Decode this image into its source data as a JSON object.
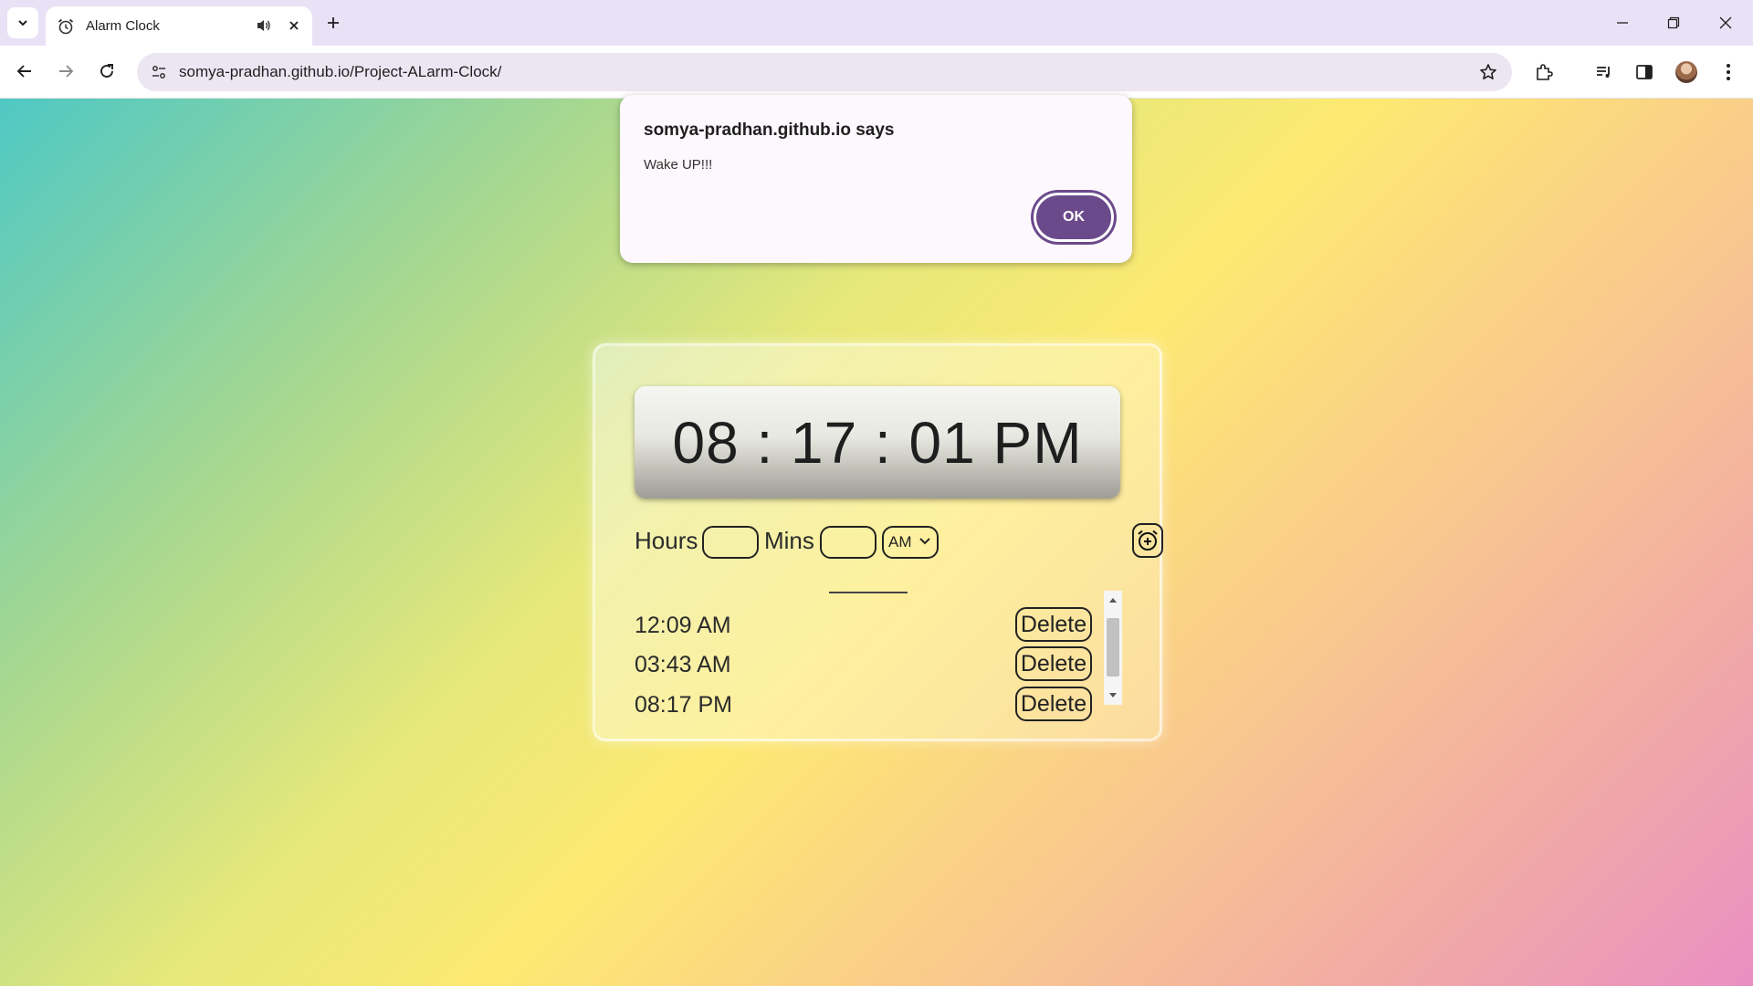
{
  "browser": {
    "tab": {
      "title": "Alarm Clock",
      "favicon": "alarm-clock-icon",
      "audio_icon": "speaker-icon"
    },
    "url": "somya-pradhan.github.io/Project-ALarm-Clock/",
    "accent": "#e9e1f5"
  },
  "dialog": {
    "title": "somya-pradhan.github.io says",
    "message": "Wake UP!!!",
    "ok_label": "OK",
    "button_color": "#6b4a8c"
  },
  "clock": {
    "display": "08 : 17 : 01 PM"
  },
  "controls": {
    "hours_label": "Hours",
    "mins_label": "Mins",
    "hours_value": "",
    "mins_value": "",
    "ampm_selected": "AM",
    "add_icon": "alarm-add-icon"
  },
  "alarms": [
    {
      "time": "12:09 AM",
      "delete_label": "Delete"
    },
    {
      "time": "03:43 AM",
      "delete_label": "Delete"
    },
    {
      "time": "08:17 PM",
      "delete_label": "Delete"
    }
  ]
}
